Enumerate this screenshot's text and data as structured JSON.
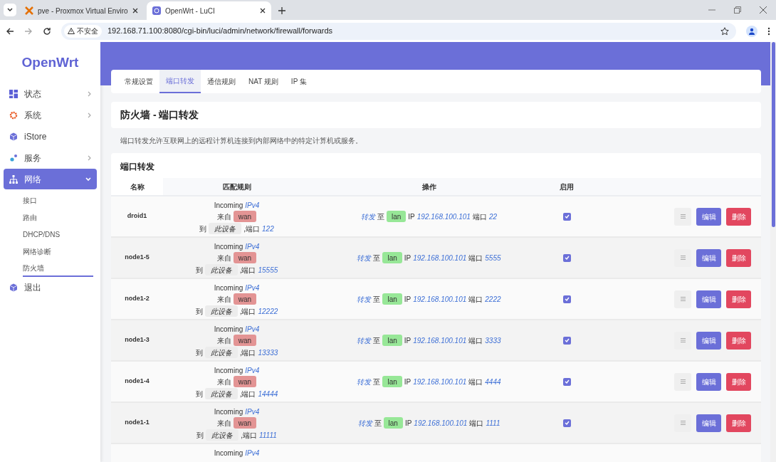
{
  "browser": {
    "tabs": [
      {
        "title": "pve - Proxmox Virtual Enviro",
        "selected": false
      },
      {
        "title": "OpenWrt - LuCI",
        "selected": true
      }
    ],
    "security": "不安全",
    "url": "192.168.71.100:8080/cgi-bin/luci/admin/network/firewall/forwards"
  },
  "sidebar": {
    "logo": "OpenWrt",
    "items": [
      {
        "label": "状态",
        "selected": false,
        "submenu": true,
        "expanded": false
      },
      {
        "label": "系统",
        "selected": false,
        "submenu": true,
        "expanded": false
      },
      {
        "label": "iStore",
        "selected": false,
        "submenu": false,
        "expanded": false
      },
      {
        "label": "服务",
        "selected": false,
        "submenu": true,
        "expanded": false
      },
      {
        "label": "网络",
        "selected": true,
        "submenu": true,
        "expanded": true,
        "children": [
          {
            "label": "接口",
            "selected": false
          },
          {
            "label": "路由",
            "selected": false
          },
          {
            "label": "DHCP/DNS",
            "selected": false
          },
          {
            "label": "网络诊断",
            "selected": false
          },
          {
            "label": "防火墙",
            "selected": true
          }
        ]
      },
      {
        "label": "退出",
        "selected": false,
        "submenu": false,
        "expanded": false
      }
    ]
  },
  "tabs": [
    {
      "label": "常规设置",
      "selected": false
    },
    {
      "label": "端口转发",
      "selected": true
    },
    {
      "label": "通信规则",
      "selected": false
    },
    {
      "label": "NAT 规则",
      "selected": false
    },
    {
      "label": "IP 集",
      "selected": false
    }
  ],
  "page_title": "防火墙 - 端口转发",
  "description": "端口转发允许互联网上的远程计算机连接到内部网络中的特定计算机或服务。",
  "section_title": "端口转发",
  "columns": [
    "名称",
    "匹配规则",
    "操作",
    "启用"
  ],
  "rows": [
    {
      "name": "droid1",
      "proto": "Incoming",
      "family": "IPv4",
      "from": "来自",
      "src_zone": "wan",
      "to": "到",
      "dest": "此设备",
      "port_label": ",端口",
      "port": "122",
      "action": "转发",
      "action_to": "至",
      "dest_zone": "lan",
      "ip_label": "IP",
      "ip": "192.168.100.101",
      "dport_label": "端口",
      "dport": "22",
      "enabled": true,
      "edit": "编辑",
      "delete": "删除"
    },
    {
      "name": "node1-5",
      "proto": "Incoming",
      "family": "IPv4",
      "from": "来自",
      "src_zone": "wan",
      "to": "到",
      "dest": "此设备",
      "port_label": ",端口",
      "port": "15555",
      "action": "转发",
      "action_to": "至",
      "dest_zone": "lan",
      "ip_label": "IP",
      "ip": "192.168.100.101",
      "dport_label": "端口",
      "dport": "5555",
      "enabled": true,
      "edit": "编辑",
      "delete": "删除"
    },
    {
      "name": "node1-2",
      "proto": "Incoming",
      "family": "IPv4",
      "from": "来自",
      "src_zone": "wan",
      "to": "到",
      "dest": "此设备",
      "port_label": ",端口",
      "port": "12222",
      "action": "转发",
      "action_to": "至",
      "dest_zone": "lan",
      "ip_label": "IP",
      "ip": "192.168.100.101",
      "dport_label": "端口",
      "dport": "2222",
      "enabled": true,
      "edit": "编辑",
      "delete": "删除"
    },
    {
      "name": "node1-3",
      "proto": "Incoming",
      "family": "IPv4",
      "from": "来自",
      "src_zone": "wan",
      "to": "到",
      "dest": "此设备",
      "port_label": ",端口",
      "port": "13333",
      "action": "转发",
      "action_to": "至",
      "dest_zone": "lan",
      "ip_label": "IP",
      "ip": "192.168.100.101",
      "dport_label": "端口",
      "dport": "3333",
      "enabled": true,
      "edit": "编辑",
      "delete": "删除"
    },
    {
      "name": "node1-4",
      "proto": "Incoming",
      "family": "IPv4",
      "from": "来自",
      "src_zone": "wan",
      "to": "到",
      "dest": "此设备",
      "port_label": ",端口",
      "port": "14444",
      "action": "转发",
      "action_to": "至",
      "dest_zone": "lan",
      "ip_label": "IP",
      "ip": "192.168.100.101",
      "dport_label": "端口",
      "dport": "4444",
      "enabled": true,
      "edit": "编辑",
      "delete": "删除"
    },
    {
      "name": "node1-1",
      "proto": "Incoming",
      "family": "IPv4",
      "from": "来自",
      "src_zone": "wan",
      "to": "到",
      "dest": "此设备",
      "port_label": ",端口",
      "port": "11111",
      "action": "转发",
      "action_to": "至",
      "dest_zone": "lan",
      "ip_label": "IP",
      "ip": "192.168.100.101",
      "dport_label": "端口",
      "dport": "1111",
      "enabled": true,
      "edit": "编辑",
      "delete": "删除"
    },
    {
      "proto": "Incoming",
      "family": "IPv4"
    }
  ]
}
